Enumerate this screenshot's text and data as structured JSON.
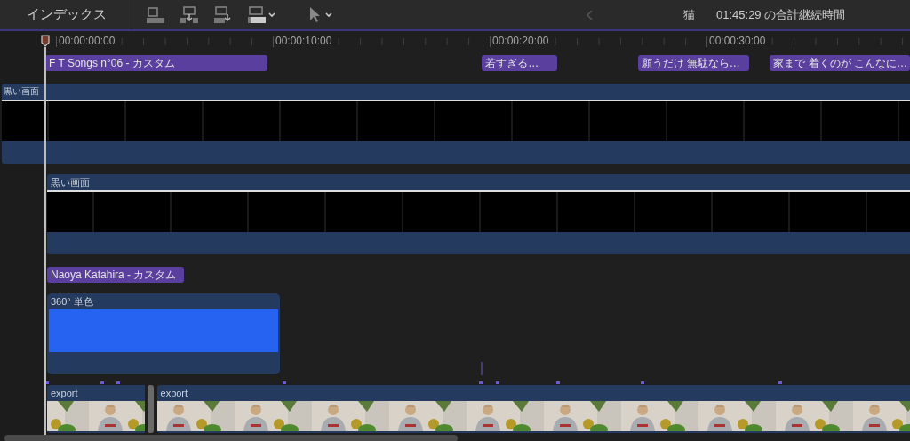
{
  "toolbar": {
    "index_label": "インデックス",
    "project_name": "猫",
    "duration": "01:45:29 の合計継続時間"
  },
  "ruler": {
    "ticks": [
      "00:00:00:00",
      "00:00:10:00",
      "00:00:20:00",
      "00:00:30:00"
    ]
  },
  "titles": [
    {
      "text": "F T Songs  n°06 - カスタム"
    },
    {
      "text": "若すぎる…"
    },
    {
      "text": "願うだけ 無駄なら…"
    },
    {
      "text": "家まで 着くのが こんなに…"
    }
  ],
  "clips": [
    {
      "kind": "black",
      "label": "黒い画面"
    },
    {
      "kind": "black",
      "label": "黒い画面"
    }
  ],
  "lower_title": {
    "text": "Naoya Katahira - カスタム"
  },
  "solid": {
    "label": "360° 単色",
    "color": "#2563f0"
  },
  "video_clips": [
    {
      "label": "export"
    },
    {
      "label": "export"
    }
  ]
}
